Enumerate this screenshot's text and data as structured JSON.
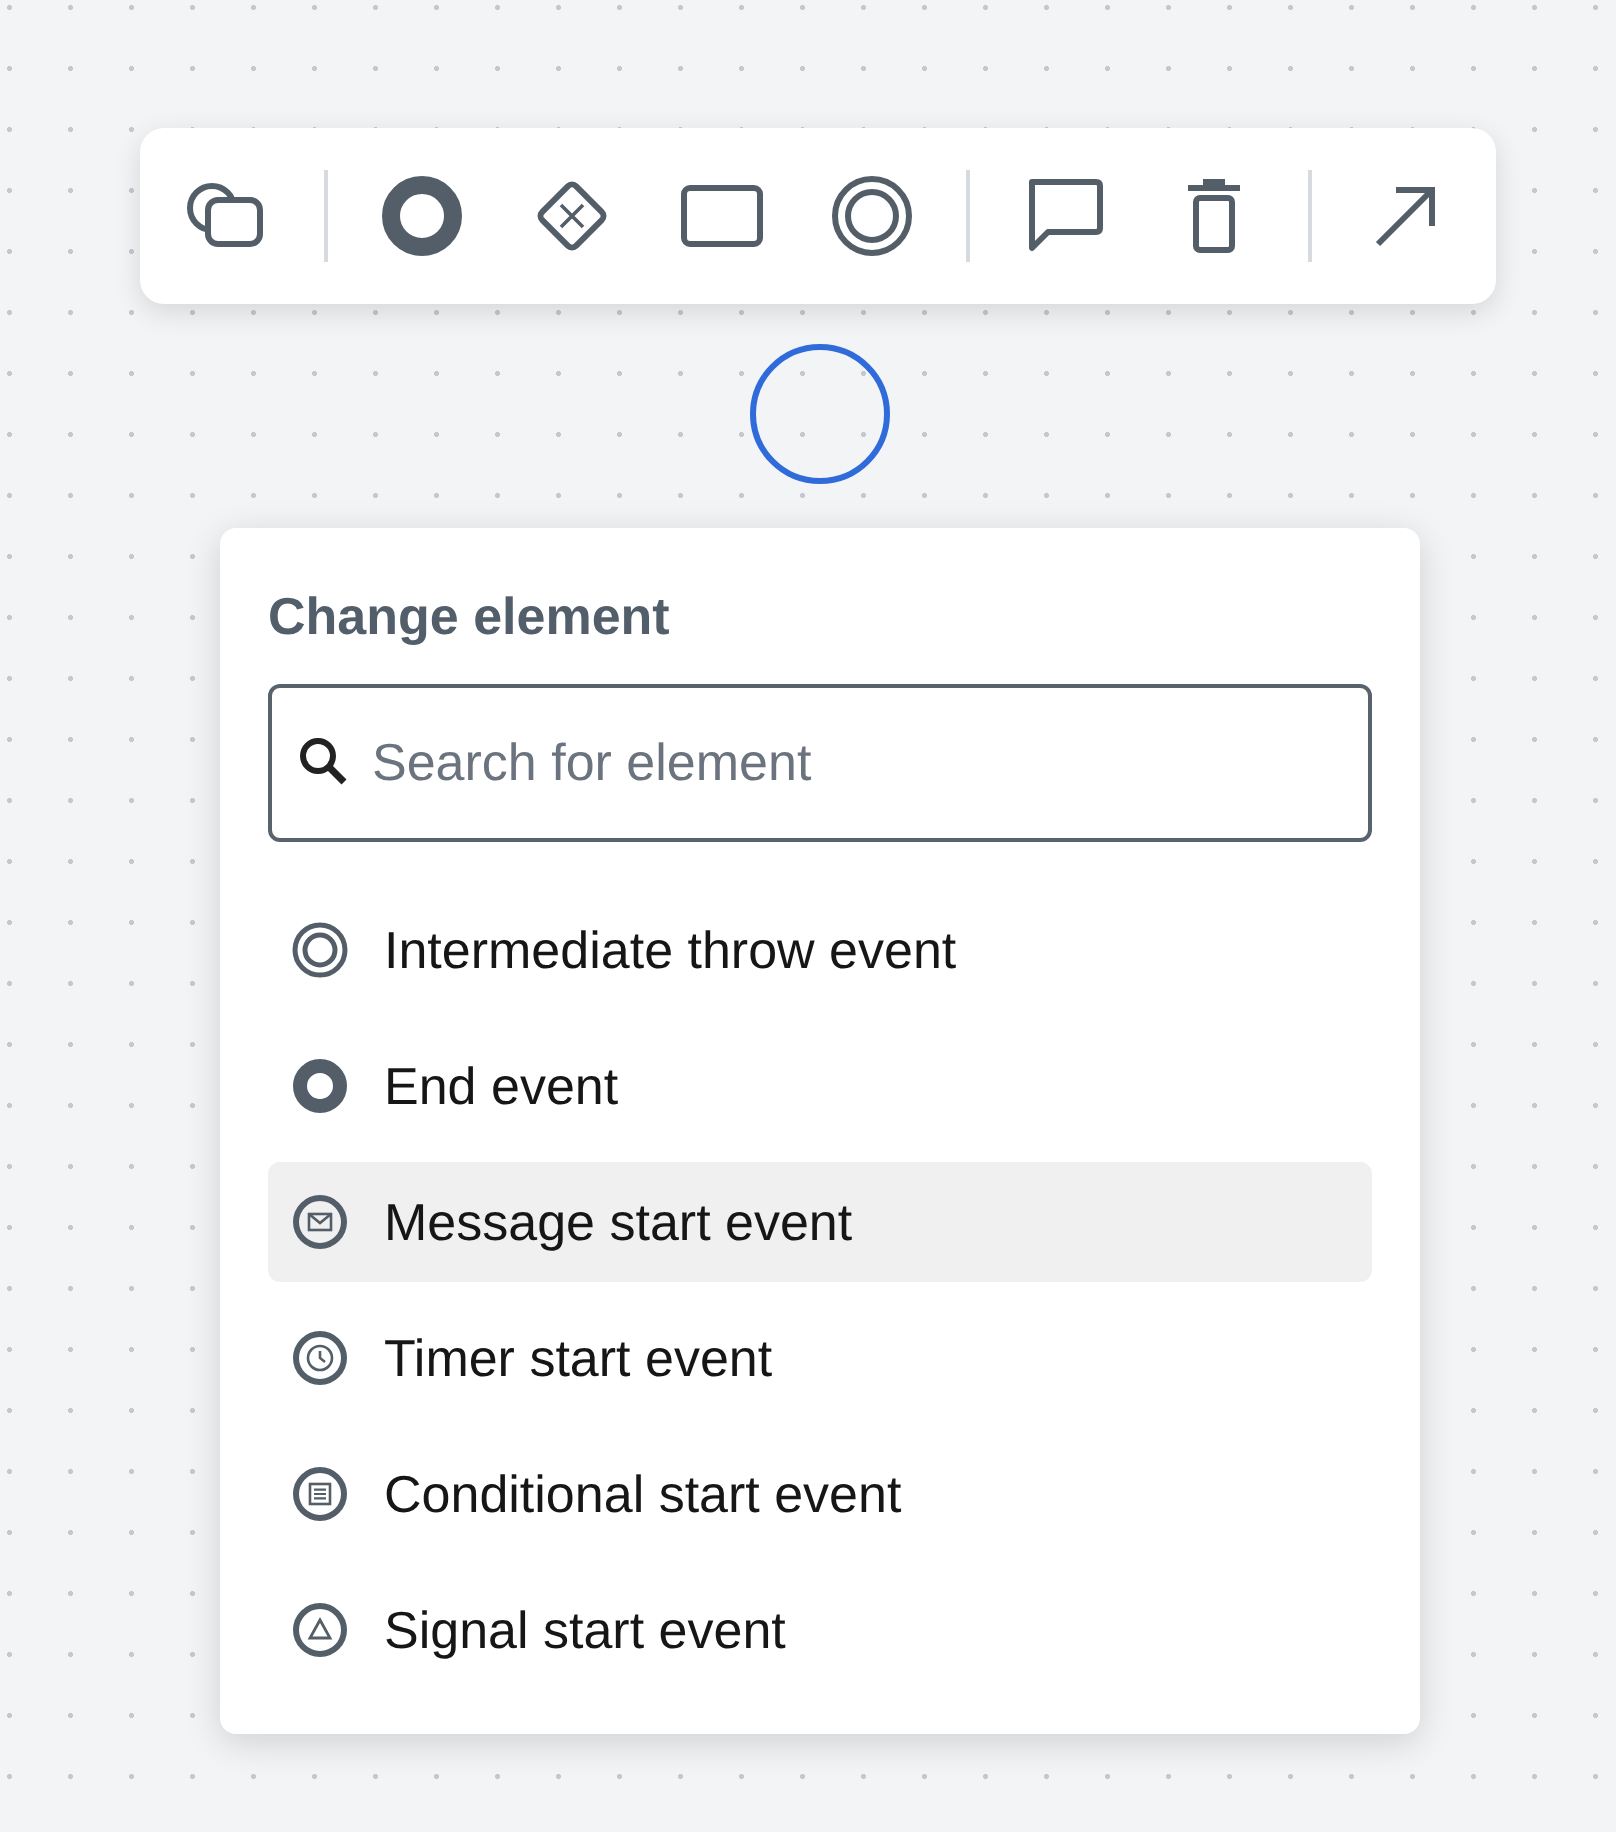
{
  "popup": {
    "title": "Change element",
    "search": {
      "placeholder": "Search for element"
    },
    "items": [
      {
        "label": "Intermediate throw event",
        "kind": "intermediate",
        "selected": false
      },
      {
        "label": "End event",
        "kind": "end",
        "selected": false
      },
      {
        "label": "Message start event",
        "kind": "message",
        "selected": true
      },
      {
        "label": "Timer start event",
        "kind": "timer",
        "selected": false
      },
      {
        "label": "Conditional start event",
        "kind": "conditional",
        "selected": false
      },
      {
        "label": "Signal start event",
        "kind": "signal",
        "selected": false
      }
    ]
  }
}
